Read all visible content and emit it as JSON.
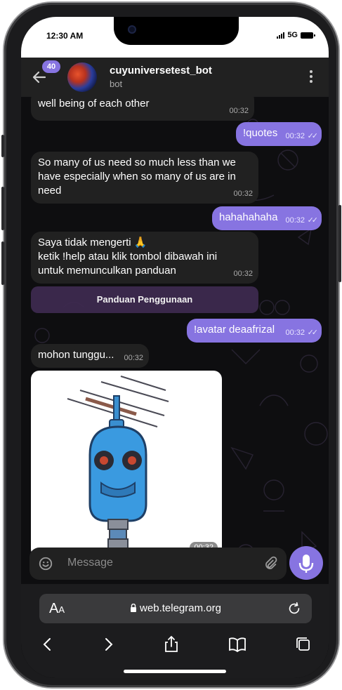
{
  "status": {
    "time": "12:30 AM",
    "network": "5G"
  },
  "header": {
    "unread_count": "40",
    "bot_name": "cuyuniversetest_bot",
    "subtitle": "bot"
  },
  "messages": [
    {
      "type": "in",
      "text": "well being of each other",
      "time": "00:32"
    },
    {
      "type": "out",
      "text": "!quotes",
      "time": "00:32"
    },
    {
      "type": "in",
      "lines": [
        "So many of us need so much less than we",
        "have especially when so many of us are in",
        "need"
      ],
      "time": "00:32"
    },
    {
      "type": "out",
      "text": "hahahahaha",
      "time": "00:32"
    },
    {
      "type": "in",
      "lines": [
        "Saya tidak mengerti 🙏",
        "ketik !help atau klik tombol dibawah ini",
        "untuk memunculkan panduan"
      ],
      "time": "00:32"
    },
    {
      "type": "out",
      "text": "!avatar deaafrizal",
      "time": "00:32"
    },
    {
      "type": "in",
      "text": "mohon tunggu...",
      "time": "00:32"
    },
    {
      "type": "image",
      "time": "00:32"
    }
  ],
  "keyboard_button": "Panduan Penggunaan",
  "composer": {
    "placeholder": "Message"
  },
  "browser": {
    "aa_big": "A",
    "aa_small": "A",
    "url": "web.telegram.org"
  },
  "colors": {
    "accent": "#8774e1",
    "bubble_in": "#212121",
    "header_bg": "#212121",
    "chat_bg": "#0e0e10"
  }
}
